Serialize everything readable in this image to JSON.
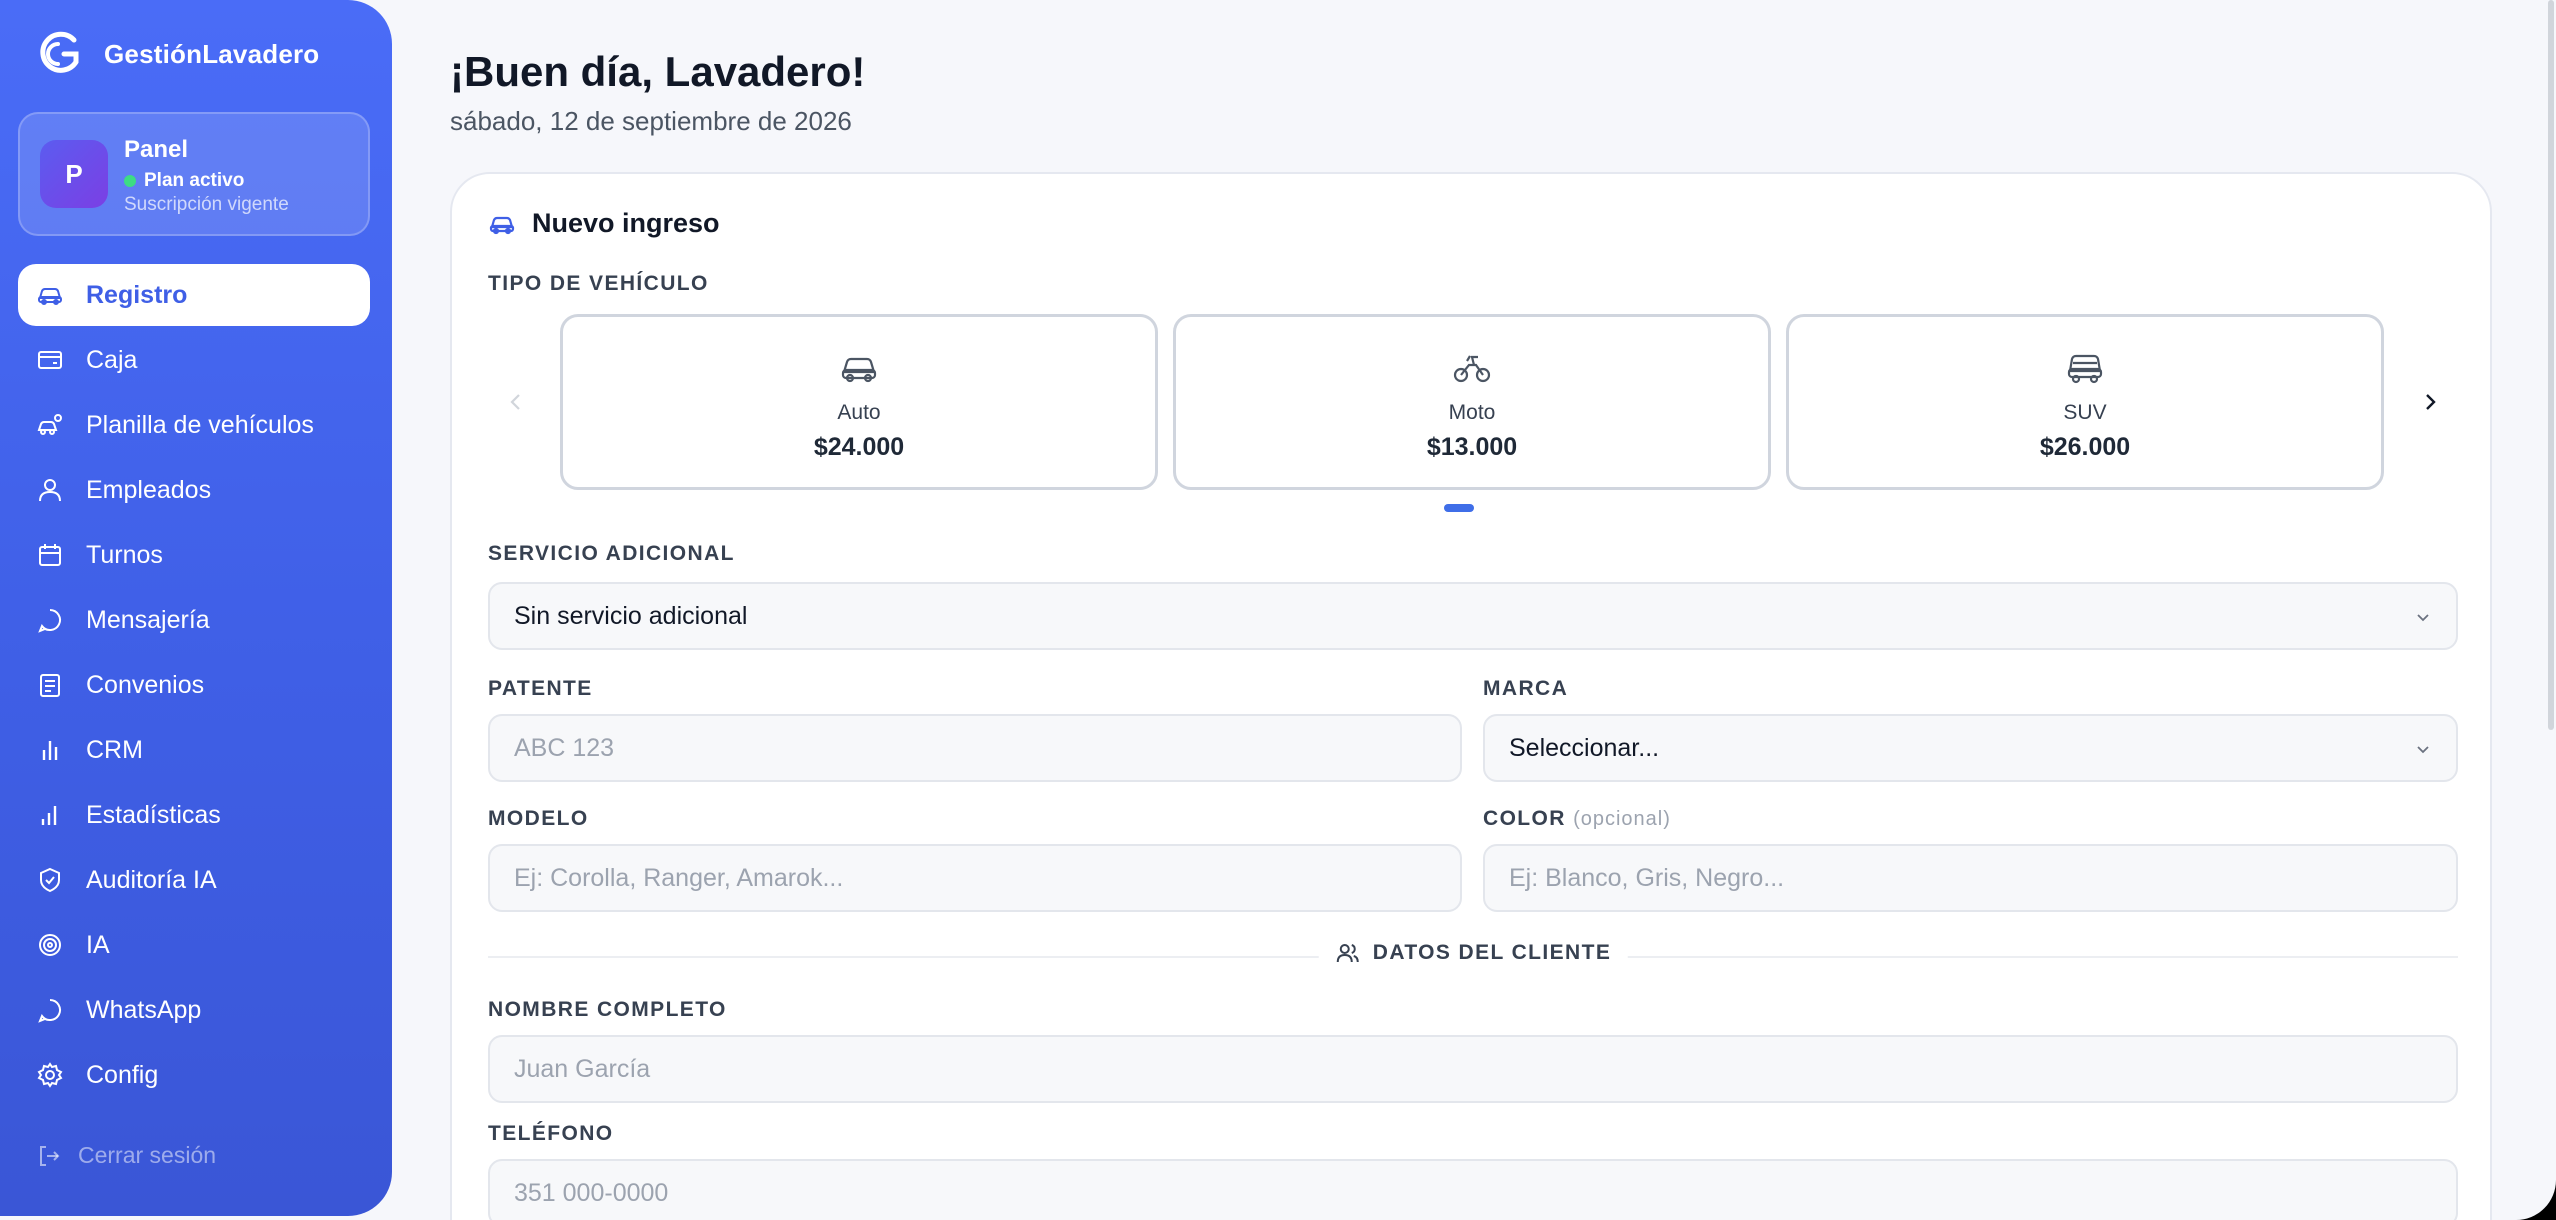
{
  "brand": {
    "name": "GestiónLavadero"
  },
  "panel": {
    "avatar_letter": "P",
    "title": "Panel",
    "status": "Plan activo",
    "subtitle": "Suscripción vigente"
  },
  "nav": [
    {
      "label": "Registro",
      "icon": "car-icon",
      "active": true
    },
    {
      "label": "Caja",
      "icon": "wallet-icon"
    },
    {
      "label": "Planilla de vehículos",
      "icon": "car-list-icon"
    },
    {
      "label": "Empleados",
      "icon": "user-icon"
    },
    {
      "label": "Turnos",
      "icon": "calendar-icon"
    },
    {
      "label": "Mensajería",
      "icon": "chat-icon"
    },
    {
      "label": "Convenios",
      "icon": "document-icon"
    },
    {
      "label": "CRM",
      "icon": "bar-chart-icon"
    },
    {
      "label": "Estadísticas",
      "icon": "stats-icon"
    },
    {
      "label": "Auditoría IA",
      "icon": "shield-icon"
    },
    {
      "label": "IA",
      "icon": "target-icon"
    },
    {
      "label": "WhatsApp",
      "icon": "whatsapp-icon"
    },
    {
      "label": "Config",
      "icon": "gear-icon"
    }
  ],
  "logout": "Cerrar sesión",
  "header": {
    "greeting": "¡Buen día, Lavadero!",
    "date": "sábado, 12 de septiembre de 2026"
  },
  "form": {
    "title": "Nuevo ingreso",
    "vehicle_type_label": "TIPO DE VEHÍCULO",
    "vehicles": [
      {
        "name": "Auto",
        "price": "$24.000",
        "icon": "car-icon"
      },
      {
        "name": "Moto",
        "price": "$13.000",
        "icon": "motorcycle-icon"
      },
      {
        "name": "SUV",
        "price": "$26.000",
        "icon": "suv-icon"
      }
    ],
    "extra_service_label": "SERVICIO ADICIONAL",
    "extra_service_value": "Sin servicio adicional",
    "plate_label": "PATENTE",
    "plate_placeholder": "ABC 123",
    "brand_label": "MARCA",
    "brand_value": "Seleccionar...",
    "model_label": "MODELO",
    "model_placeholder": "Ej: Corolla, Ranger, Amarok...",
    "color_label": "COLOR",
    "color_optional": "(opcional)",
    "color_placeholder": "Ej: Blanco, Gris, Negro...",
    "client_section": "DATOS DEL CLIENTE",
    "name_label": "NOMBRE COMPLETO",
    "name_placeholder": "Juan García",
    "phone_label": "TELÉFONO",
    "phone_placeholder": "351 000-0000"
  },
  "colors": {
    "accent": "#3f5fe6",
    "sidebar_top": "#4a6cf7",
    "status_green": "#3ddc84"
  }
}
